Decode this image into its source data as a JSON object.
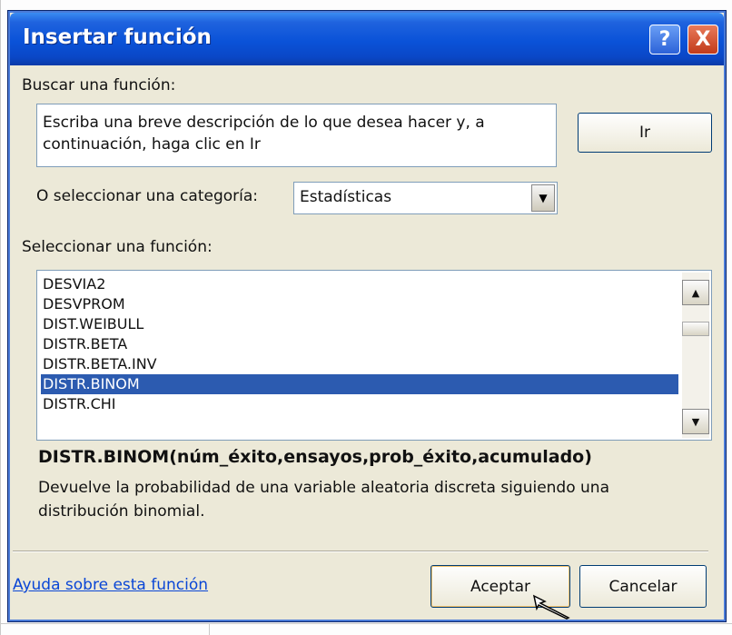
{
  "dialog": {
    "title": "Insertar función",
    "help_glyph": "?",
    "close_glyph": "X"
  },
  "search": {
    "label": "Buscar una función:",
    "value": "Escriba una breve descripción de lo que desea hacer y, a continuación, haga clic en Ir",
    "go_button": "Ir"
  },
  "category": {
    "label": "O seleccionar una categoría:",
    "selected": "Estadísticas"
  },
  "functions": {
    "label": "Seleccionar una función:",
    "items": [
      {
        "name": "DESVIA2"
      },
      {
        "name": "DESVPROM"
      },
      {
        "name": "DIST.WEIBULL"
      },
      {
        "name": "DISTR.BETA"
      },
      {
        "name": "DISTR.BETA.INV"
      },
      {
        "name": "DISTR.BINOM"
      },
      {
        "name": "DISTR.CHI"
      }
    ],
    "selected_index": 5
  },
  "details": {
    "signature": "DISTR.BINOM(núm_éxito,ensayos,prob_éxito,acumulado)",
    "description": "Devuelve la probabilidad de una variable aleatoria discreta siguiendo una distribución binomial."
  },
  "footer": {
    "help_link": "Ayuda sobre esta función",
    "ok_button": "Aceptar",
    "cancel_button": "Cancelar"
  },
  "icons": {
    "help": "help-icon",
    "close": "close-icon",
    "dropdown": "chevron-down-icon",
    "scroll_up": "arrow-up-icon",
    "scroll_down": "arrow-down-icon",
    "cursor": "mouse-pointer-icon"
  },
  "colors": {
    "title_bar": "#0a52d8",
    "dialog_bg": "#ece9d8",
    "selection": "#2c5bb0",
    "link": "#0a46d6",
    "close_button": "#c13b1b"
  }
}
